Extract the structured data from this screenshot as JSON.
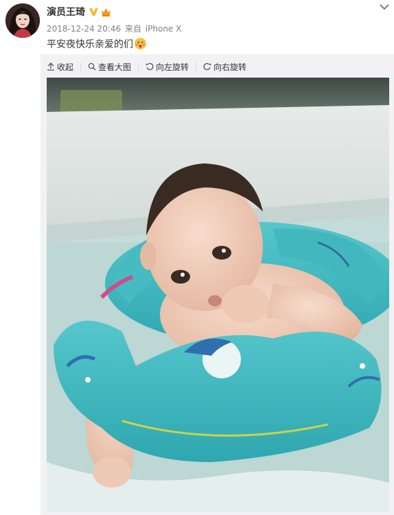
{
  "post": {
    "author": "演员王琦",
    "timestamp": "2018-12-24 20:46",
    "source_prefix": "来自",
    "device": "iPhone X",
    "text": "平安夜快乐亲爱的们",
    "emoji_icon": "shy-face-emoji"
  },
  "toolbar": {
    "collapse_label": "收起",
    "view_large_label": "查看大图",
    "rotate_left_label": "向左旋转",
    "rotate_right_label": "向右旋转"
  },
  "colors": {
    "verified_badge": "#f6b91a",
    "member_badge": "#f29a1d",
    "text_primary": "#333333",
    "text_meta": "#808080",
    "card_background": "#f2f2f5"
  },
  "photo": {
    "description_icon": "baby-in-swim-float-photo"
  }
}
